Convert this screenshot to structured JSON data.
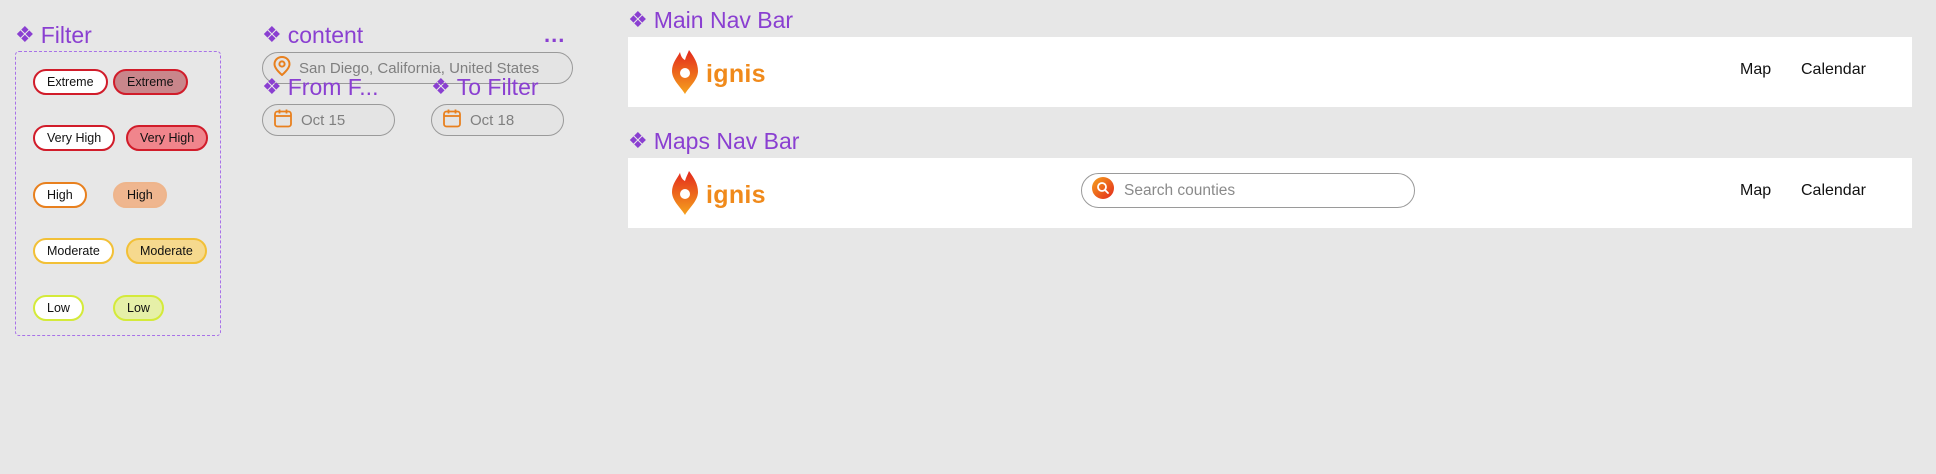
{
  "filter": {
    "title": "Filter",
    "chips": [
      {
        "label": "Extreme",
        "variant": "outline"
      },
      {
        "label": "Extreme",
        "variant": "filled"
      },
      {
        "label": "Very High",
        "variant": "outline"
      },
      {
        "label": "Very High",
        "variant": "filled"
      },
      {
        "label": "High",
        "variant": "outline"
      },
      {
        "label": "High",
        "variant": "filled"
      },
      {
        "label": "Moderate",
        "variant": "outline"
      },
      {
        "label": "Moderate",
        "variant": "filled"
      },
      {
        "label": "Low",
        "variant": "outline"
      },
      {
        "label": "Low",
        "variant": "filled"
      }
    ]
  },
  "content": {
    "title": "content",
    "more": "...",
    "location_value": "San Diego, California, United States"
  },
  "from_filter": {
    "title": "From F...",
    "date": "Oct 15"
  },
  "to_filter": {
    "title": "To Filter",
    "date": "Oct 18"
  },
  "main_nav": {
    "title": "Main Nav Bar",
    "brand": "ignis",
    "links": [
      "Map",
      "Calendar"
    ]
  },
  "maps_nav": {
    "title": "Maps Nav Bar",
    "brand": "ignis",
    "search_placeholder": "Search counties",
    "links": [
      "Map",
      "Calendar"
    ]
  },
  "colors": {
    "title_purple": "#8a3fd1",
    "extreme": "#d11c2a",
    "very_high": "#d11c2a",
    "high": "#e8801e",
    "moderate": "#f2c037",
    "low": "#d4ea3a",
    "brand_orange": "#f08a1b"
  },
  "icons": {
    "component_marker": "four-diamond-icon",
    "location": "map-pin-icon",
    "date": "calendar-icon",
    "logo": "flame-pin-icon",
    "search": "search-icon"
  }
}
